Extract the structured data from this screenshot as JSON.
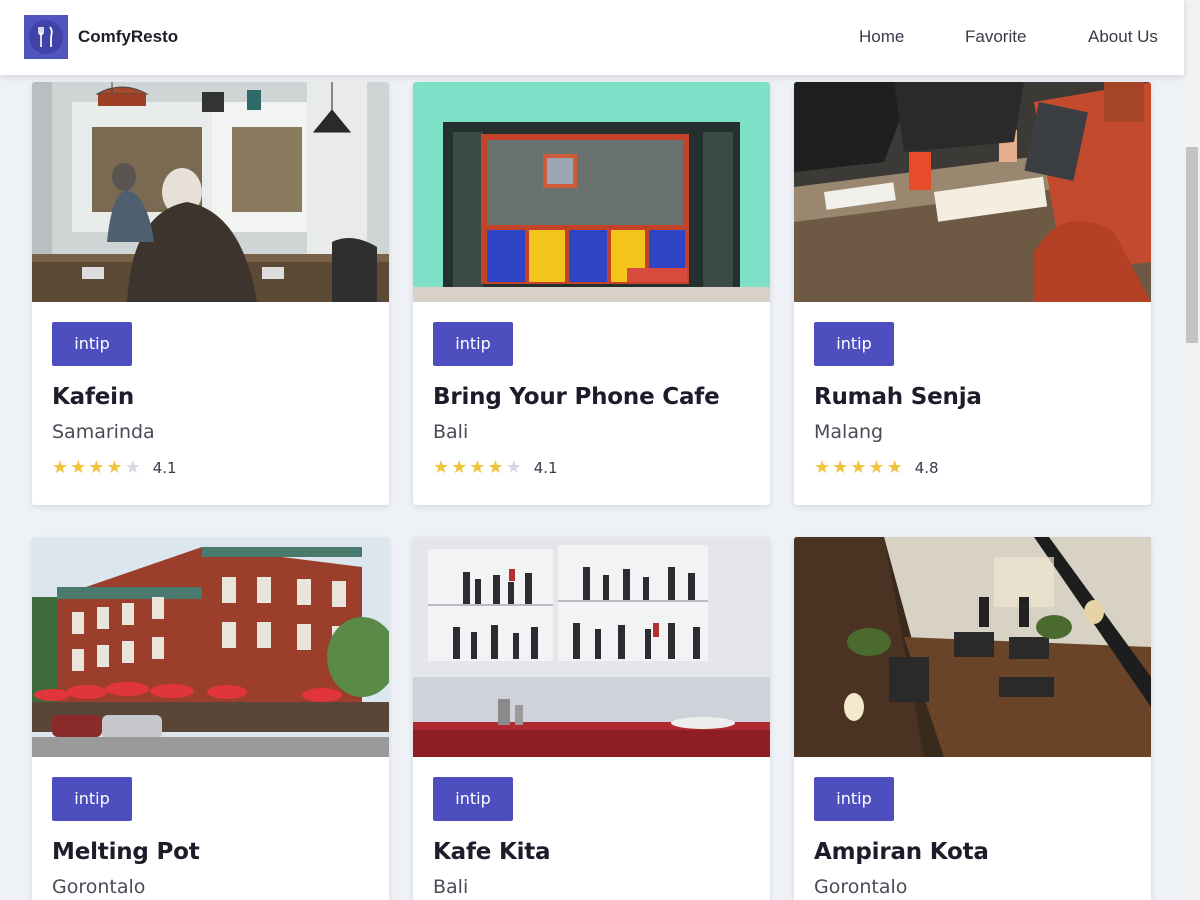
{
  "header": {
    "brand": "ComfyResto",
    "nav": {
      "home": "Home",
      "favorite": "Favorite",
      "about": "About Us"
    }
  },
  "cards": [
    {
      "button": "intip",
      "name": "Kafein",
      "city": "Samarinda",
      "rating": "4.1",
      "rating_value": 4.1,
      "image": "cafe interior with elderly man"
    },
    {
      "button": "intip",
      "name": "Bring Your Phone Cafe",
      "city": "Bali",
      "rating": "4.1",
      "rating_value": 4.1,
      "image": "colorful shopfront window"
    },
    {
      "button": "intip",
      "name": "Rumah Senja",
      "city": "Malang",
      "rating": "4.8",
      "rating_value": 4.8,
      "image": "people working at wooden table"
    },
    {
      "button": "intip",
      "name": "Melting Pot",
      "city": "Gorontalo",
      "image": "brick building with red umbrellas"
    },
    {
      "button": "intip",
      "name": "Kafe Kita",
      "city": "Bali",
      "image": "bar shelves with bottles"
    },
    {
      "button": "intip",
      "name": "Ampiran Kota",
      "city": "Gorontalo",
      "image": "cafe interior from above"
    }
  ],
  "colors": {
    "accent": "#4e4fbf",
    "star": "#f0c33c",
    "background": "#eef1f6"
  }
}
